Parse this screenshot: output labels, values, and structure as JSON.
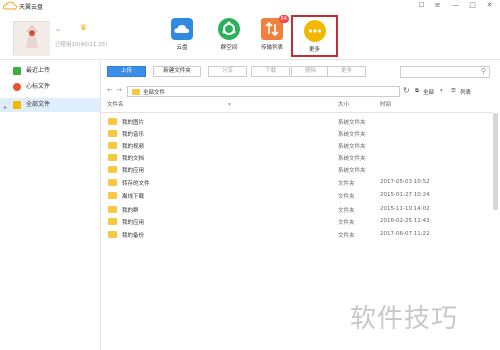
{
  "app": {
    "title": "天翼云盘"
  },
  "window": {
    "minimize": "—",
    "maximize": "□",
    "close": "✕",
    "menu": "≡",
    "skin": "☐"
  },
  "user": {
    "name": "≈",
    "usage": "已使用20(40/11.25)"
  },
  "nav": [
    {
      "label": "云盘",
      "color": "#2f8be0",
      "icon": "cloud-icon"
    },
    {
      "label": "群空间",
      "color": "#2bb05c",
      "icon": "group-icon"
    },
    {
      "label": "传输列表",
      "color": "#f0803c",
      "icon": "transfer-icon",
      "badge": "64"
    },
    {
      "label": "更多",
      "color": "#f5b800",
      "icon": "more-icon"
    }
  ],
  "sidebar": [
    {
      "label": "最近上传",
      "color": "#3cae3c",
      "icon": "recent-icon"
    },
    {
      "label": "心标文件",
      "color": "#e8542c",
      "icon": "heart-icon"
    },
    {
      "label": "全部文件",
      "color": "#f5b800",
      "icon": "folder-icon",
      "active": true
    }
  ],
  "toolbar": {
    "upload": "上传",
    "new_folder": "新建文件夹",
    "share": "分享",
    "download": "下载",
    "delete": "删除",
    "more": "更多"
  },
  "path": {
    "current": "全部文件",
    "back": "←",
    "forward": "→",
    "refresh": "↻",
    "select_all": "全部",
    "list": "列表"
  },
  "columns": {
    "name": "文件名",
    "size": "大小",
    "time": "时间"
  },
  "files": [
    {
      "name": "我的图片",
      "size": "系统文件夹",
      "time": ""
    },
    {
      "name": "我的音乐",
      "size": "系统文件夹",
      "time": ""
    },
    {
      "name": "我的视频",
      "size": "系统文件夹",
      "time": ""
    },
    {
      "name": "我的文档",
      "size": "系统文件夹",
      "time": ""
    },
    {
      "name": "我的应用",
      "size": "系统文件夹",
      "time": ""
    },
    {
      "name": "转存的文件",
      "size": "文件夹",
      "time": "2017-05-03 10:52"
    },
    {
      "name": "离线下载",
      "size": "文件夹",
      "time": "2015-01-27 10:24"
    },
    {
      "name": "我的群",
      "size": "文件夹",
      "time": "2015-11-10 14:02"
    },
    {
      "name": "我的应用",
      "size": "文件夹",
      "time": "2016-02-25 11:43"
    },
    {
      "name": "我的备份",
      "size": "文件夹",
      "time": "2017-06-07 11:22"
    }
  ],
  "watermark": "软件技巧"
}
